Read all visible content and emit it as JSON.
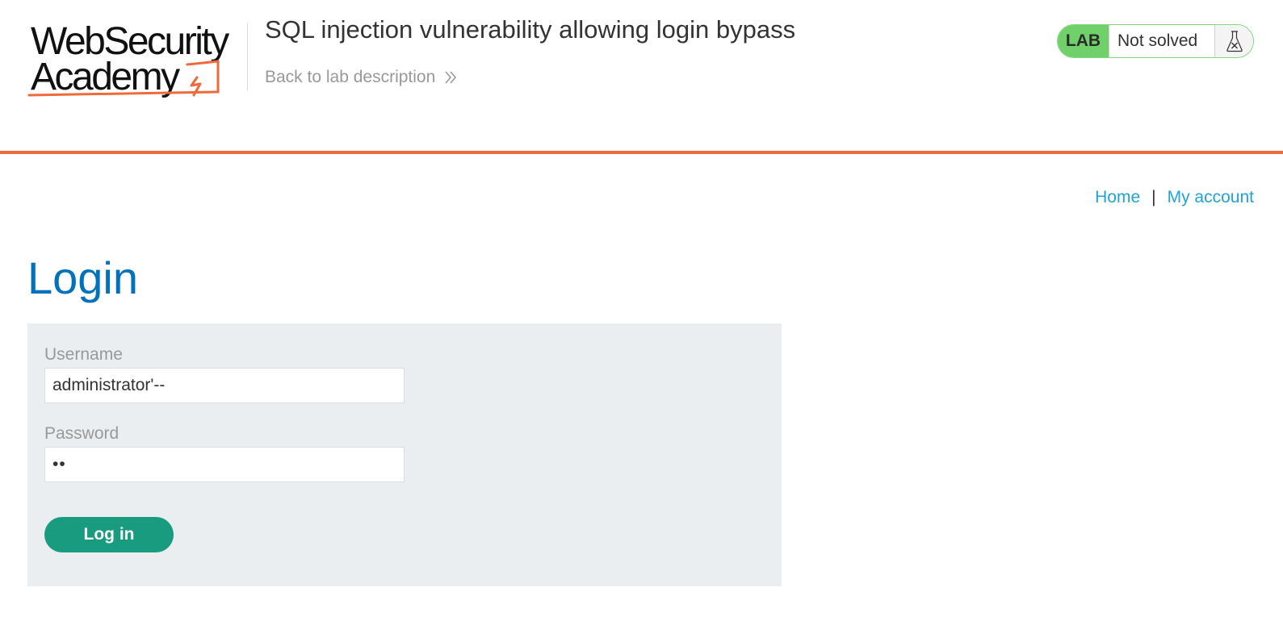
{
  "header": {
    "logo_line1": "WebSecurity",
    "logo_line2": "Academy",
    "lab_title": "SQL injection vulnerability allowing login bypass",
    "back_link": "Back to lab description",
    "lab_status": {
      "tag": "LAB",
      "status": "Not solved",
      "icon": "flask-icon"
    }
  },
  "nav": {
    "home": "Home",
    "separator": "|",
    "my_account": "My account"
  },
  "main": {
    "title": "Login",
    "form": {
      "username_label": "Username",
      "username_value": "administrator'--",
      "password_label": "Password",
      "password_value": "xx",
      "submit_label": "Log in"
    }
  },
  "colors": {
    "accent_orange": "#ee6a3a",
    "link_blue": "#21a3da",
    "title_blue": "#0071bc",
    "button_green": "#199b80",
    "lab_green": "#70d16a",
    "panel_bg": "#eaeef0"
  }
}
